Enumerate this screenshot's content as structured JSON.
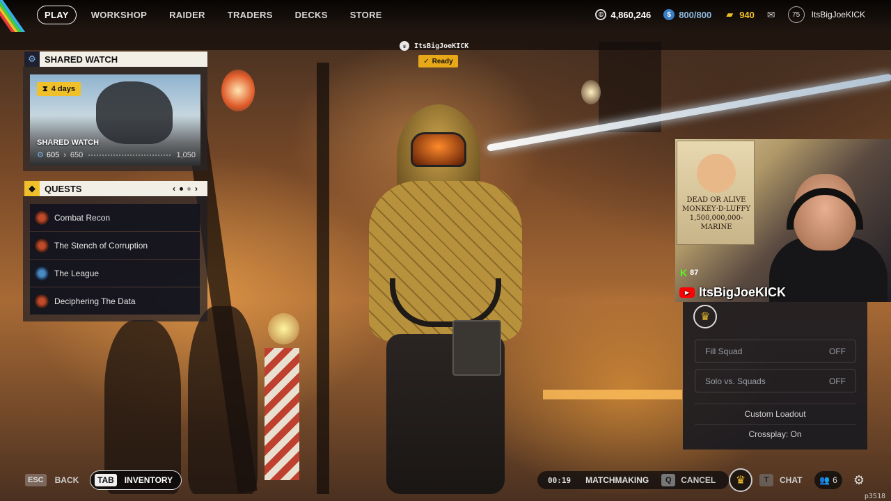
{
  "nav": {
    "items": [
      {
        "label": "PLAY",
        "active": true
      },
      {
        "label": "WORKSHOP"
      },
      {
        "label": "RAIDER"
      },
      {
        "label": "TRADERS"
      },
      {
        "label": "DECKS"
      },
      {
        "label": "STORE"
      }
    ]
  },
  "currencies": {
    "coins": {
      "value": "4,860,246",
      "icon": "coin-icon"
    },
    "raider_tokens": {
      "value": "800/800",
      "icon": "token-icon"
    },
    "cred": {
      "value": "940",
      "icon": "cred-icon"
    },
    "mail_icon": "mail-icon"
  },
  "profile": {
    "level": "75",
    "username": "ItsBigJoeKICK"
  },
  "shared_watch": {
    "header": "SHARED WATCH",
    "badge": "4  days",
    "card_title": "SHARED WATCH",
    "current": "605",
    "next": "650",
    "max": "1,050"
  },
  "quests": {
    "header": "QUESTS",
    "items": [
      {
        "label": "Combat Recon",
        "icon": "red"
      },
      {
        "label": "The Stench of Corruption",
        "icon": "red"
      },
      {
        "label": "The League",
        "icon": "blue"
      },
      {
        "label": "Deciphering The Data",
        "icon": "red"
      }
    ]
  },
  "lobby": {
    "player_name": "ItsBigJoeKICK",
    "status": "Ready"
  },
  "stream_overlay": {
    "poster_text": "DEAD OR ALIVE MONKEY·D·LUFFY 1,500,000,000- MARINE",
    "kick_viewers": "87",
    "channel_name": "ItsBigJoeKICK"
  },
  "squad": {
    "options": [
      {
        "label": "Fill Squad",
        "value": "OFF"
      },
      {
        "label": "Solo vs. Squads",
        "value": "OFF"
      }
    ],
    "custom_loadout": "Custom Loadout",
    "crossplay": "Crossplay: On"
  },
  "bottom": {
    "back_key": "ESC",
    "back_label": "BACK",
    "inventory_key": "TAB",
    "inventory_label": "INVENTORY",
    "timer": "00:19",
    "matchmaking": "MATCHMAKING",
    "cancel_key": "Q",
    "cancel_label": "CANCEL",
    "chat_key": "T",
    "chat_label": "CHAT",
    "friends_count": "6",
    "build_id": "p3518"
  },
  "colors": {
    "accent_yellow": "#f0c02a",
    "kick_green": "#53fc18",
    "youtube_red": "#ff0000",
    "ready_orange": "#e8a818"
  }
}
